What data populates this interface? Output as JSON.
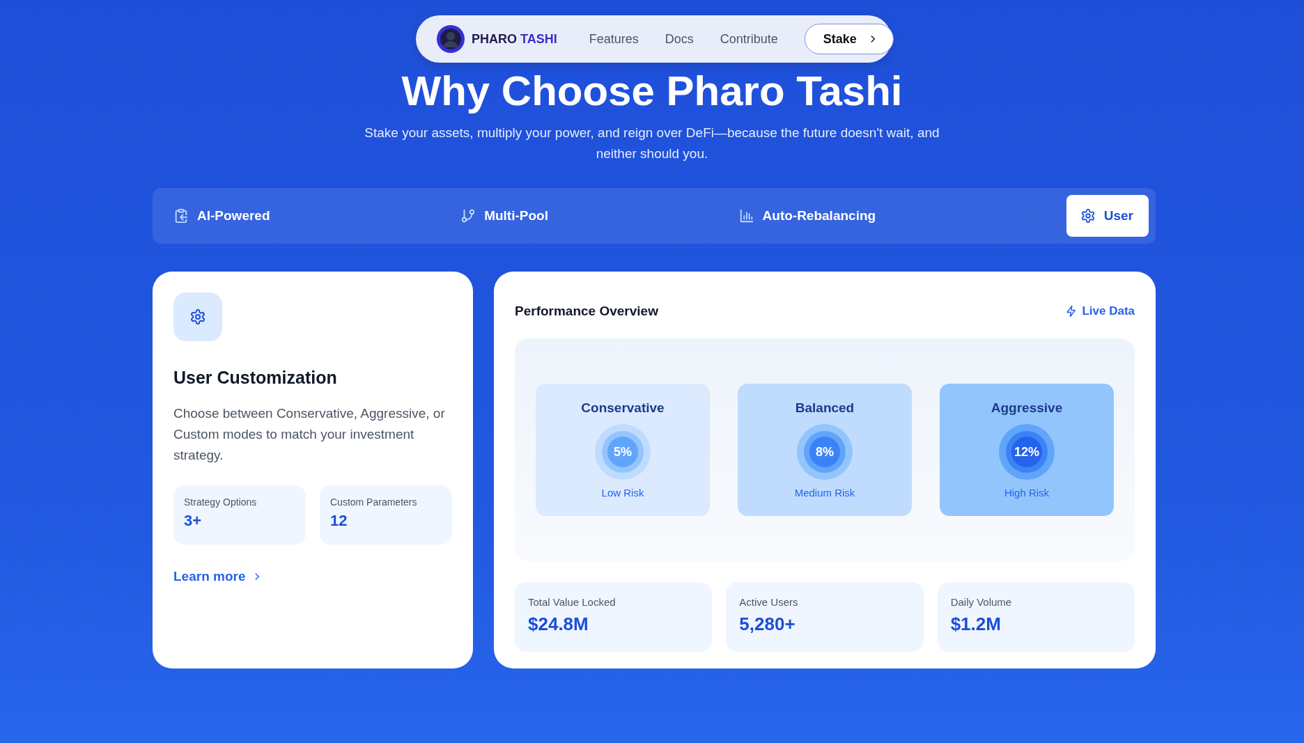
{
  "nav": {
    "brand": {
      "name": "PHARO",
      "accent": "TASHI"
    },
    "links": [
      "Features",
      "Docs",
      "Contribute"
    ],
    "cta": "Stake"
  },
  "hero": {
    "title": "Why Choose Pharo Tashi",
    "subtitle": "Stake your assets, multiply your power, and reign over DeFi—because the future doesn't wait, and neither should you."
  },
  "tabs": [
    {
      "label": "AI-Powered",
      "selected": false
    },
    {
      "label": "Multi-Pool",
      "selected": false
    },
    {
      "label": "Auto-Rebalancing",
      "selected": false
    },
    {
      "label": "User",
      "selected": true
    }
  ],
  "feature_card": {
    "title": "User Customization",
    "description": "Choose between Conservative, Aggressive, or Custom modes to match your investment strategy.",
    "stats": [
      {
        "label": "Strategy Options",
        "value": "3+"
      },
      {
        "label": "Custom Parameters",
        "value": "12"
      }
    ],
    "link": "Learn more"
  },
  "performance": {
    "title": "Performance Overview",
    "live_label": "Live Data",
    "profiles": [
      {
        "name": "Conservative",
        "rate": "5%",
        "risk": "Low Risk",
        "color": "#dbeafe"
      },
      {
        "name": "Balanced",
        "rate": "8%",
        "risk": "Medium Risk",
        "color": "#bfdbfe"
      },
      {
        "name": "Aggressive",
        "rate": "12%",
        "risk": "High Risk",
        "color": "#93c5fd"
      }
    ],
    "stats": [
      {
        "label": "Total Value Locked",
        "value": "$24.8M"
      },
      {
        "label": "Active Users",
        "value": "5,280+"
      },
      {
        "label": "Daily Volume",
        "value": "$1.2M"
      }
    ]
  }
}
